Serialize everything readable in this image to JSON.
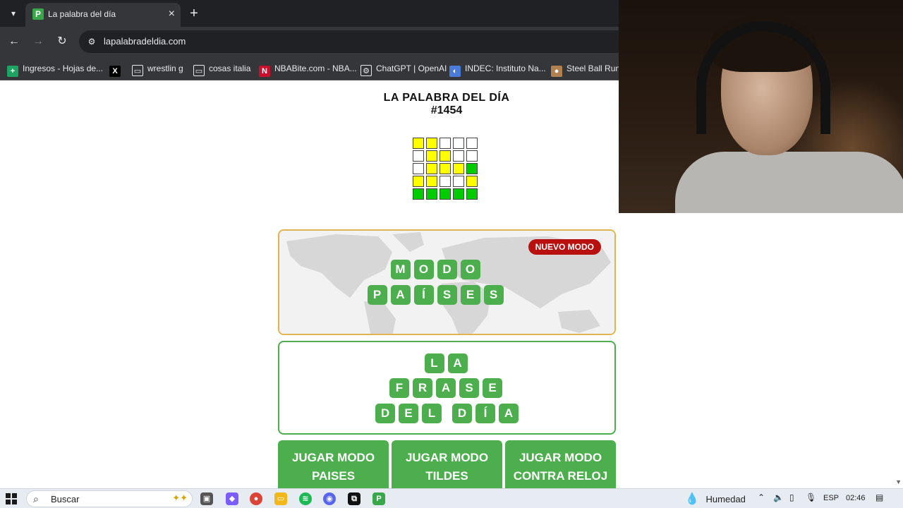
{
  "browser": {
    "tab_title": "La palabra del día",
    "tab_favicon": "P",
    "url": "lapalabradeldia.com",
    "bookmarks": [
      {
        "label": "Ingresos - Hojas de...",
        "icon": "sheets-icon",
        "color": "#1ea362"
      },
      {
        "label": "",
        "icon": "x-icon",
        "color": "#000000"
      },
      {
        "label": "wrestlin g",
        "icon": "folder-icon",
        "color": "#e8eaed"
      },
      {
        "label": "cosas italia",
        "icon": "folder-icon",
        "color": "#e8eaed"
      },
      {
        "label": "NBABite.com - NBA...",
        "icon": "nba-icon",
        "color": "#c8102e"
      },
      {
        "label": "ChatGPT | OpenAI",
        "icon": "openai-icon",
        "color": "#e8eaed"
      },
      {
        "label": "INDEC: Instituto Na...",
        "icon": "indec-icon",
        "color": "#4a7bd6"
      },
      {
        "label": "Steel Ball Run M",
        "icon": "steel-ball-icon",
        "color": "#b08050"
      }
    ]
  },
  "game": {
    "title": "LA PALABRA DEL DÍA",
    "number": "#1454",
    "grid": [
      [
        "y",
        "y",
        "w",
        "w",
        "w"
      ],
      [
        "w",
        "y",
        "y",
        "w",
        "w"
      ],
      [
        "w",
        "y",
        "y",
        "y",
        "g"
      ],
      [
        "y",
        "y",
        "w",
        "w",
        "y"
      ],
      [
        "g",
        "g",
        "g",
        "g",
        "g"
      ]
    ],
    "colors": {
      "yellow": "#ffff00",
      "green": "#00cc00",
      "tile": "#4cae4c",
      "badge": "#b80f0f",
      "paises_border": "#e2b44e"
    }
  },
  "cards": {
    "paises": {
      "badge": "NUEVO MODO",
      "line1": [
        "M",
        "O",
        "D",
        "O"
      ],
      "line2": [
        "P",
        "A",
        "Í",
        "S",
        "E",
        "S"
      ]
    },
    "frase": {
      "line1": [
        "L",
        "A"
      ],
      "line2": [
        "F",
        "R",
        "A",
        "S",
        "E"
      ],
      "line3a": [
        "D",
        "E",
        "L"
      ],
      "line3b": [
        "D",
        "Í",
        "A"
      ]
    }
  },
  "buttons": [
    {
      "line1": "JUGAR MODO",
      "line2": "PAISES"
    },
    {
      "line1": "JUGAR MODO",
      "line2": "TILDES"
    },
    {
      "line1": "JUGAR MODO",
      "line2": "CONTRA RELOJ"
    }
  ],
  "taskbar": {
    "search_label": "Buscar",
    "weather_label": "Humedad",
    "language": "ESP",
    "time": "02:46"
  }
}
